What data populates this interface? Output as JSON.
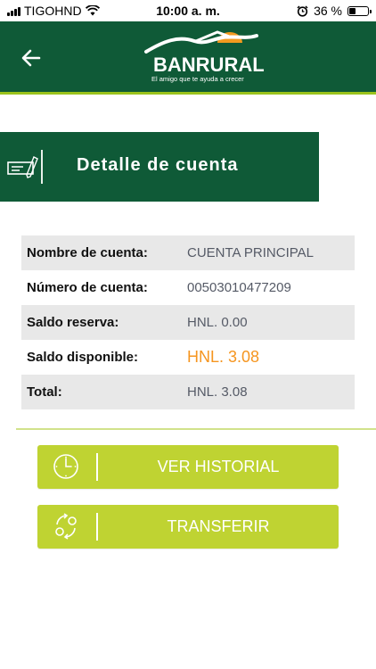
{
  "status_bar": {
    "carrier": "TIGOHND",
    "time": "10:00 a. m.",
    "battery_percent": "36 %",
    "battery_level": 0.36
  },
  "header": {
    "logo_text": "BANRURAL",
    "tagline": "El amigo que te ayuda a crecer",
    "back_icon": "arrow-left-icon"
  },
  "section": {
    "title": "Detalle de cuenta",
    "icon": "cheque-pen-icon"
  },
  "account_details": [
    {
      "label": "Nombre de cuenta:",
      "value": "CUENTA PRINCIPAL"
    },
    {
      "label": "Número de cuenta:",
      "value": "00503010477209"
    },
    {
      "label": "Saldo reserva:",
      "value": "HNL. 0.00"
    },
    {
      "label": "Saldo disponible:",
      "value": "HNL. 3.08"
    },
    {
      "label": "Total:",
      "value": "HNL. 3.08"
    }
  ],
  "actions": {
    "history": {
      "label": "VER HISTORIAL",
      "icon": "clock-icon"
    },
    "transfer": {
      "label": "TRANSFERIR",
      "icon": "transfer-cycle-icon"
    }
  },
  "colors": {
    "brand_green": "#0f5a37",
    "accent_lime": "#bfd332",
    "highlight_orange": "#f5951f",
    "row_shade": "#e8e8e8"
  }
}
